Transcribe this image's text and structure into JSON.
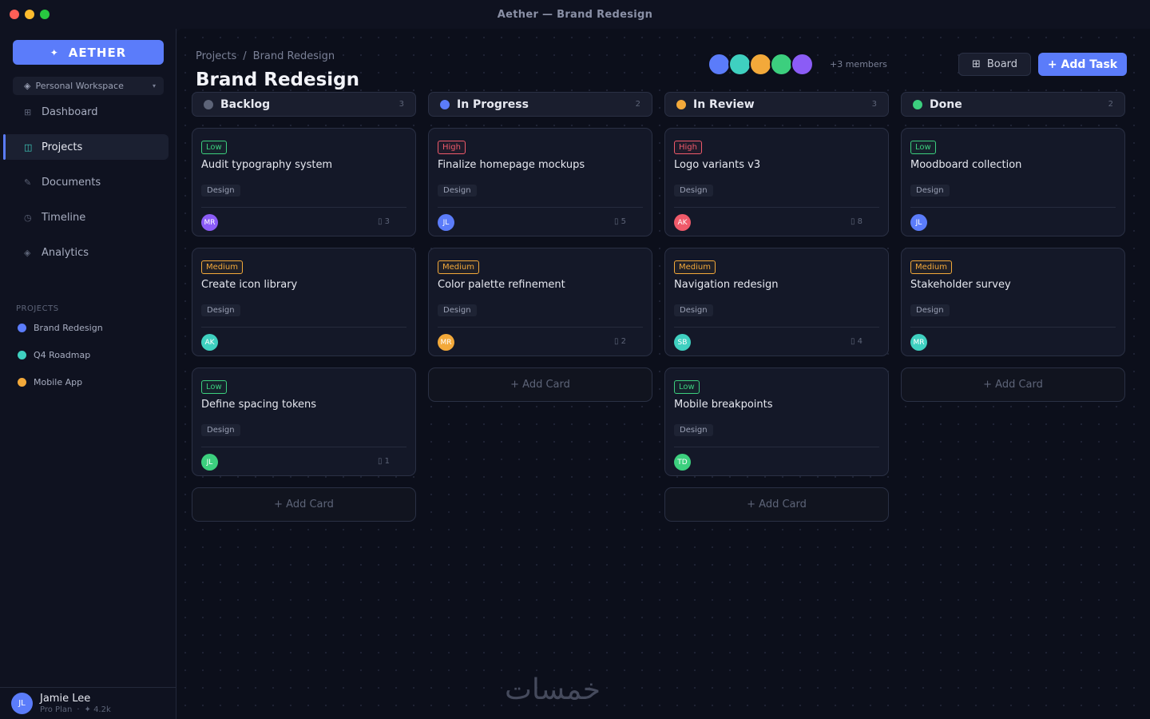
{
  "window": {
    "title": "Aether — Brand Redesign"
  },
  "sidebar": {
    "brand_icon": "✦",
    "brand": "AETHER",
    "workspace": {
      "icon": "◈",
      "label": "Personal Workspace",
      "caret": "▾"
    },
    "nav": [
      {
        "icon": "⊞",
        "label": "Dashboard",
        "active": false
      },
      {
        "icon": "◫",
        "label": "Projects",
        "active": true
      },
      {
        "icon": "✎",
        "label": "Documents",
        "active": false
      },
      {
        "icon": "◷",
        "label": "Timeline",
        "active": false
      },
      {
        "icon": "◈",
        "label": "Analytics",
        "active": false
      }
    ],
    "projects_heading": "PROJECTS",
    "projects": [
      {
        "label": "Brand Redesign",
        "color": "#5b7cfa"
      },
      {
        "label": "Q4 Roadmap",
        "color": "#3fd0c0"
      },
      {
        "label": "Mobile App",
        "color": "#f3a93a"
      }
    ],
    "user": {
      "initials": "JL",
      "name": "Jamie Lee",
      "plan": "Pro Plan",
      "sep": "·",
      "points": "✦ 4.2k"
    }
  },
  "header": {
    "breadcrumb": [
      "Projects",
      "/",
      "Brand Redesign"
    ],
    "title": "Brand Redesign",
    "member_colors": [
      "#5b7cfa",
      "#3fd0c0",
      "#f3a93a",
      "#3ccf7e",
      "#8b5cf6"
    ],
    "members_count": "+3 members",
    "board_icon": "⊞",
    "board_label": "Board",
    "add_task_label": "+ Add Task"
  },
  "columns": [
    {
      "title": "Backlog",
      "count": "3",
      "color": "#5d6478",
      "cards": [
        {
          "priority": "Low",
          "level": "low",
          "title": "Audit typography system",
          "tag": "Design",
          "assignee": "MR",
          "assignee_color": "#8b5cf6",
          "comments": "▯ 3"
        },
        {
          "priority": "Medium",
          "level": "medium",
          "title": "Create icon library",
          "tag": "Design",
          "assignee": "AK",
          "assignee_color": "#3fd0c0",
          "comments": ""
        },
        {
          "priority": "Low",
          "level": "low",
          "title": "Define spacing tokens",
          "tag": "Design",
          "assignee": "JL",
          "assignee_color": "#3ccf7e",
          "comments": "▯ 1"
        }
      ],
      "add_card": "+ Add Card"
    },
    {
      "title": "In Progress",
      "count": "2",
      "color": "#5b7cfa",
      "cards": [
        {
          "priority": "High",
          "level": "high",
          "title": "Finalize homepage mockups",
          "tag": "Design",
          "assignee": "JL",
          "assignee_color": "#5b7cfa",
          "comments": "▯ 5"
        },
        {
          "priority": "Medium",
          "level": "medium",
          "title": "Color palette refinement",
          "tag": "Design",
          "assignee": "MR",
          "assignee_color": "#f3a93a",
          "comments": "▯ 2"
        }
      ],
      "add_card": "+ Add Card"
    },
    {
      "title": "In Review",
      "count": "3",
      "color": "#f3a93a",
      "cards": [
        {
          "priority": "High",
          "level": "high",
          "title": "Logo variants v3",
          "tag": "Design",
          "assignee": "AK",
          "assignee_color": "#f05a6a",
          "comments": "▯ 8"
        },
        {
          "priority": "Medium",
          "level": "medium",
          "title": "Navigation redesign",
          "tag": "Design",
          "assignee": "SB",
          "assignee_color": "#3fd0c0",
          "comments": "▯ 4"
        },
        {
          "priority": "Low",
          "level": "low",
          "title": "Mobile breakpoints",
          "tag": "Design",
          "assignee": "TD",
          "assignee_color": "#3ccf7e",
          "comments": ""
        }
      ],
      "add_card": "+ Add Card"
    },
    {
      "title": "Done",
      "count": "2",
      "color": "#3ccf7e",
      "cards": [
        {
          "priority": "Low",
          "level": "low",
          "title": "Moodboard collection",
          "tag": "Design",
          "assignee": "JL",
          "assignee_color": "#5b7cfa",
          "comments": ""
        },
        {
          "priority": "Medium",
          "level": "medium",
          "title": "Stakeholder survey",
          "tag": "Design",
          "assignee": "MR",
          "assignee_color": "#3fd0c0",
          "comments": ""
        }
      ],
      "add_card": "+ Add Card"
    }
  ],
  "watermark": "خمسات"
}
